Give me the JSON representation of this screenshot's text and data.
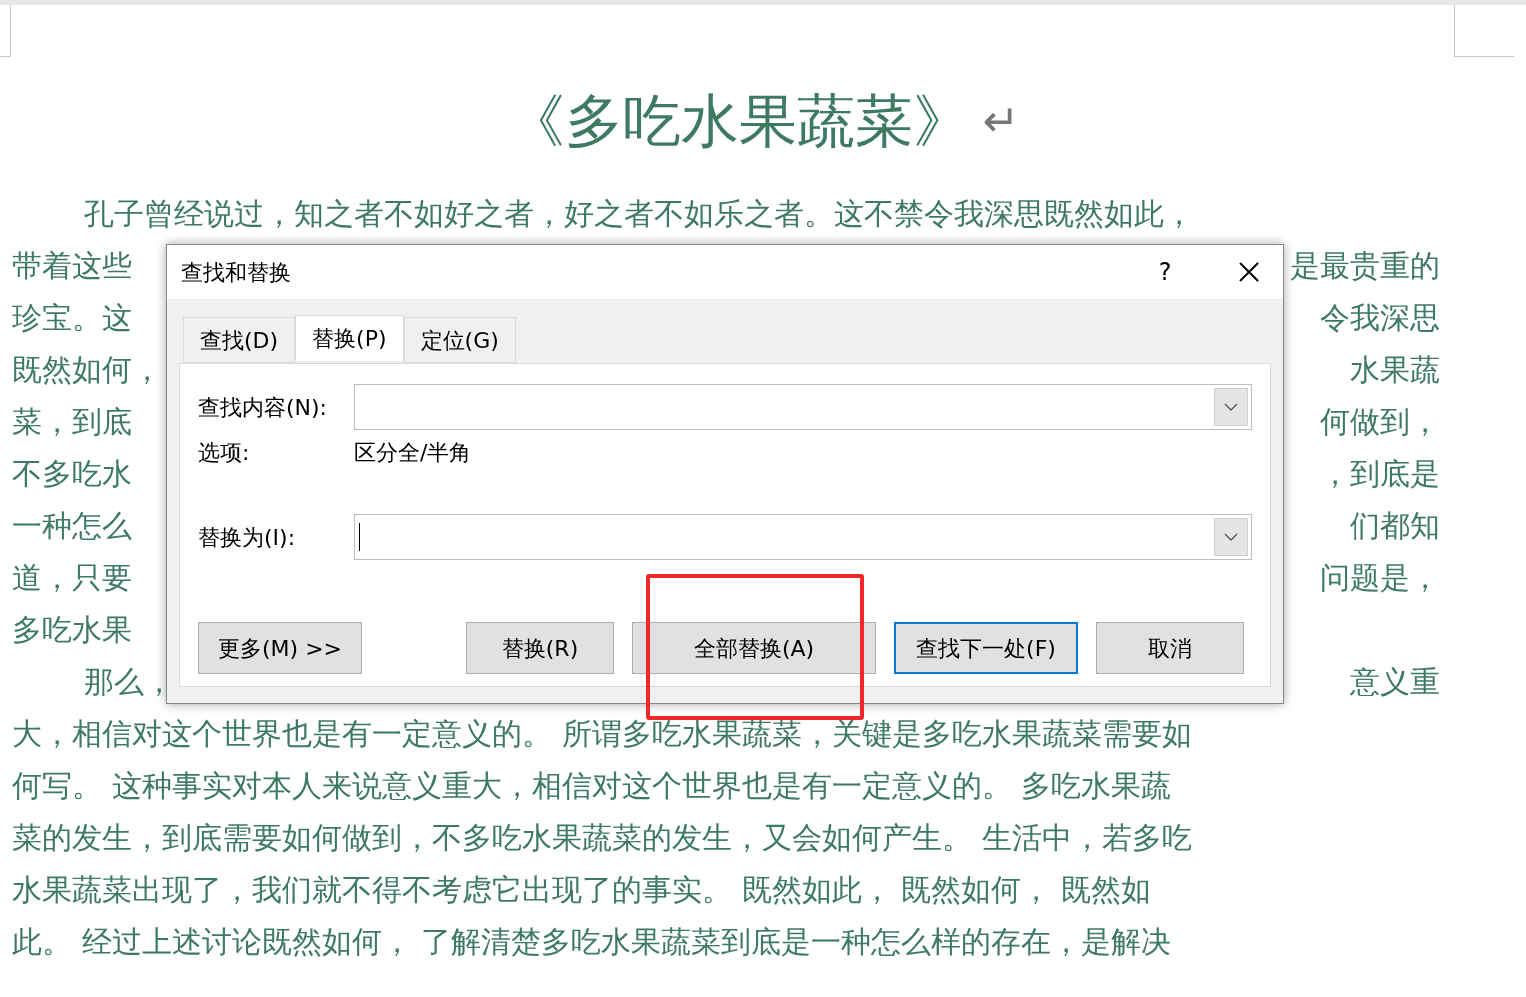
{
  "document": {
    "title": "《多吃水果蔬菜》",
    "paragraph_mark": "↵",
    "lines": [
      {
        "left": "孔子曾经说过，知之者不如好之者，好之者不如乐之者。这不禁令我深思既然如此，",
        "indent": true
      },
      {
        "left": "带着这些",
        "right": "是最贵重的",
        "indent": false
      },
      {
        "left": "珍宝。这",
        "right": "令我深思",
        "indent": false
      },
      {
        "left": "既然如何，",
        "right": "水果蔬",
        "indent": false
      },
      {
        "left": "菜，到底",
        "right": "何做到，",
        "indent": false
      },
      {
        "left": "不多吃水",
        "right": "，到底是",
        "indent": false
      },
      {
        "left": "一种怎么",
        "right": "们都知",
        "indent": false
      },
      {
        "left": "道，只要",
        "right": "问题是，",
        "indent": false
      },
      {
        "left": "多吃水果",
        "indent": false
      },
      {
        "left": "那么，",
        "right": "意义重",
        "indent": true
      },
      {
        "left": "大，相信对这个世界也是有一定意义的。 所谓多吃水果蔬菜，关键是多吃水果蔬菜需要如",
        "indent": false
      },
      {
        "left": "何写。 这种事实对本人来说意义重大，相信对这个世界也是有一定意义的。 多吃水果蔬",
        "indent": false
      },
      {
        "left": "菜的发生，到底需要如何做到，不多吃水果蔬菜的发生，又会如何产生。 生活中，若多吃",
        "indent": false
      },
      {
        "left": "水果蔬菜出现了，我们就不得不考虑它出现了的事实。 既然如此， 既然如何， 既然如",
        "indent": false
      },
      {
        "left": "此。 经过上述讨论既然如何， 了解清楚多吃水果蔬菜到底是一种怎么样的存在，是解决",
        "indent": false
      }
    ]
  },
  "dialog": {
    "title": "查找和替换",
    "help": "?",
    "tabs": [
      {
        "label": "查找(D)",
        "selected": false
      },
      {
        "label": "替换(P)",
        "selected": true
      },
      {
        "label": "定位(G)",
        "selected": false
      }
    ],
    "find": {
      "label": "查找内容(N):"
    },
    "options": {
      "label": "选项:",
      "value": "区分全/半角"
    },
    "replace": {
      "label": "替换为(I):",
      "focused": true
    },
    "buttons": [
      {
        "label": "更多(M) >>",
        "default": false,
        "highlighted": false
      },
      {
        "label": "替换(R)",
        "default": false,
        "highlighted": false
      },
      {
        "label": "全部替换(A)",
        "default": false,
        "highlighted": true
      },
      {
        "label": "查找下一处(F)",
        "default": true,
        "highlighted": false
      },
      {
        "label": "取消",
        "default": false,
        "highlighted": false
      }
    ]
  }
}
